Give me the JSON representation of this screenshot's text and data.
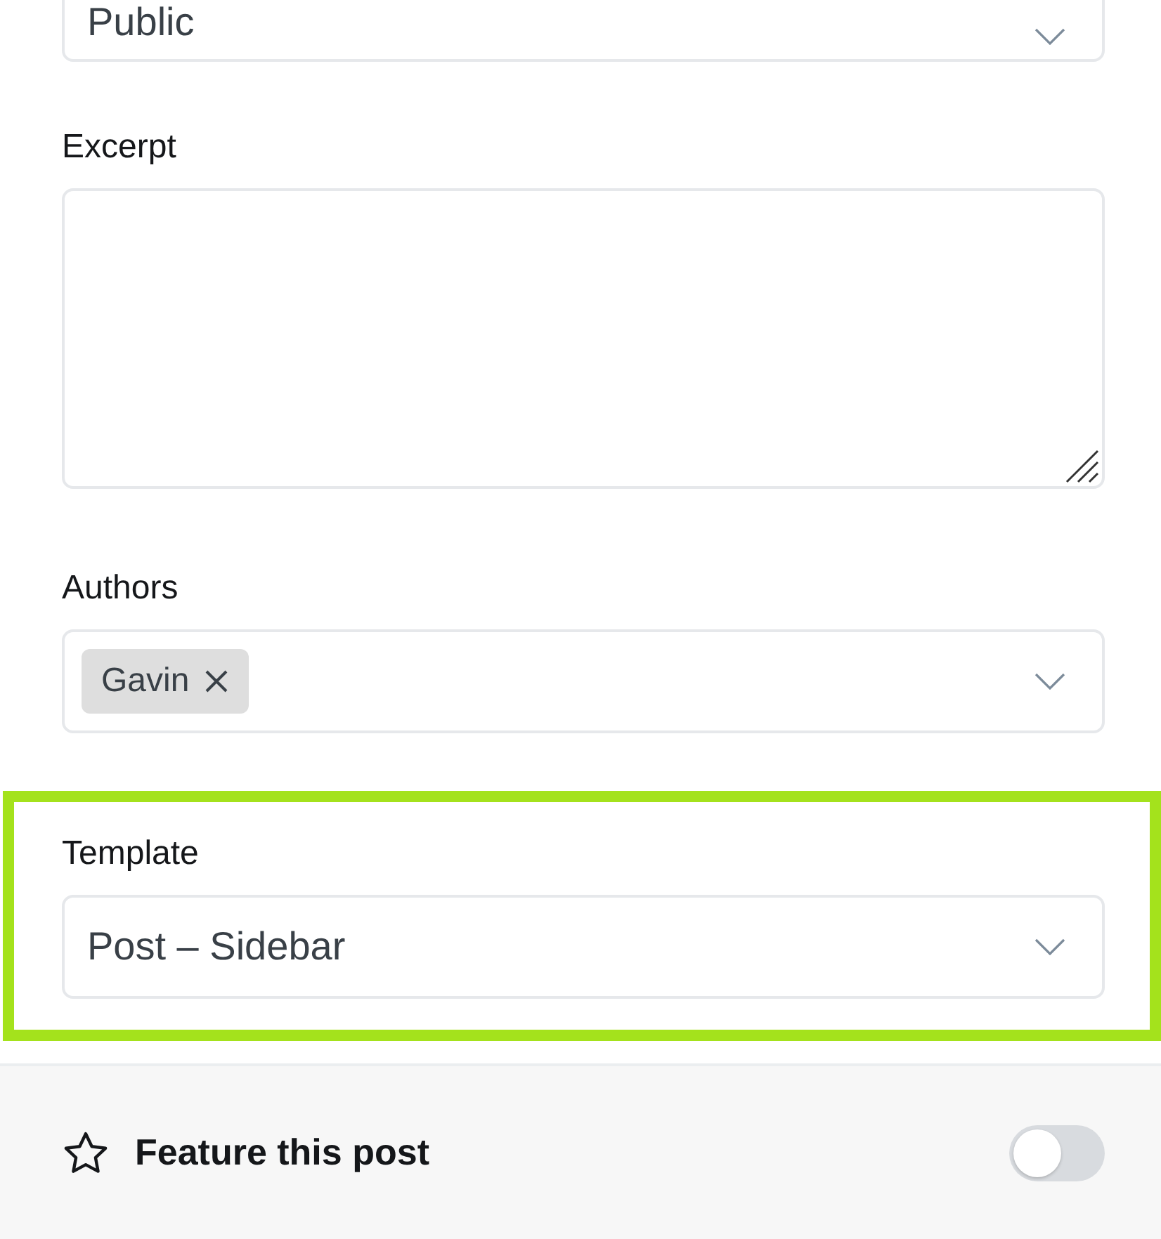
{
  "visibility": {
    "value": "Public"
  },
  "excerpt": {
    "label": "Excerpt"
  },
  "authors": {
    "label": "Authors",
    "chips": [
      {
        "label": "Gavin"
      }
    ]
  },
  "template": {
    "label": "Template",
    "value": "Post – Sidebar",
    "highlighted": true
  },
  "feature": {
    "label": "Feature this post",
    "on": false
  }
}
